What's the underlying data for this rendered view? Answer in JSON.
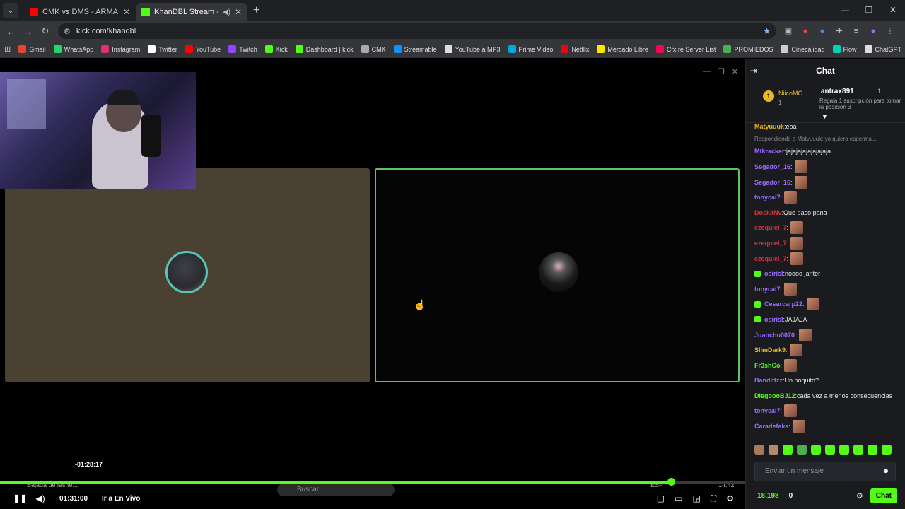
{
  "browser": {
    "tabs": [
      {
        "title": "CMK vs DMS - ARMAS LARGAS",
        "color": "#ff0000"
      },
      {
        "title": "KhanDBL Stream - Watch Li",
        "color": "#53fc18"
      }
    ],
    "url": "kick.com/khandbl",
    "bookmarks": [
      {
        "label": "Gmail",
        "color": "#ea4335"
      },
      {
        "label": "WhatsApp",
        "color": "#25d366"
      },
      {
        "label": "Instagram",
        "color": "#e1306c"
      },
      {
        "label": "Twitter",
        "color": "#ffffff"
      },
      {
        "label": "YouTube",
        "color": "#ff0000"
      },
      {
        "label": "Twitch",
        "color": "#9146ff"
      },
      {
        "label": "Kick",
        "color": "#53fc18"
      },
      {
        "label": "Dashboard | kick",
        "color": "#53fc18"
      },
      {
        "label": "CMK",
        "color": "#aaaaaa"
      },
      {
        "label": "Streamable",
        "color": "#0f90fa"
      },
      {
        "label": "YouTube a MP3",
        "color": "#dddddd"
      },
      {
        "label": "Prime Video",
        "color": "#00a8e1"
      },
      {
        "label": "Netflix",
        "color": "#e50914"
      },
      {
        "label": "Mercado Libre",
        "color": "#ffe600"
      },
      {
        "label": "Cfx.re Server List",
        "color": "#f40552"
      },
      {
        "label": "PROMIEDOS",
        "color": "#4caf50"
      },
      {
        "label": "Cinecalidad",
        "color": "#cccccc"
      },
      {
        "label": "Flow",
        "color": "#00d4b4"
      },
      {
        "label": "ChatGPT",
        "color": "#dddddd"
      }
    ]
  },
  "player": {
    "seek_tooltip": "-01:28:17",
    "timecode": "01:31:00",
    "go_live": "Ir a En Vivo",
    "taskbar_ghost": {
      "notice": "Bajada de las te...",
      "search": "Buscar",
      "lang": "ESP",
      "clock": "14:42"
    },
    "accent": "#53fc18",
    "progress_pct": 90
  },
  "chat": {
    "title": "Chat",
    "pinned": {
      "rank": "1",
      "top_gifter": "NiicoMC",
      "top_gifter_count": "1",
      "second_gifter": "antrax891",
      "second_count": "1",
      "cta": "Regala 1 suscripción para tomar la posición 3"
    },
    "messages": [
      {
        "user": "Matyuuuk",
        "color": "#e8b923",
        "text": "eoa"
      },
      {
        "reply": "Respondiendo a Matyuuuk: yo quiero esperma..."
      },
      {
        "user": "Mtkracker",
        "color": "#9b6cff",
        "text": "jajajajajajajajaja"
      },
      {
        "user": "Segador_16",
        "color": "#9b6cff",
        "emote": true
      },
      {
        "user": "Segador_16",
        "color": "#9b6cff",
        "emote": true
      },
      {
        "user": "tonycai7",
        "color": "#9b6cff",
        "emote": true
      },
      {
        "user": "DoskaNv",
        "color": "#e0303a",
        "text": "Que paso pana"
      },
      {
        "user": "ezequiel_7",
        "color": "#e0303a",
        "emote": true
      },
      {
        "user": "ezequiel_7",
        "color": "#e0303a",
        "emote": true
      },
      {
        "user": "ezequiel_7",
        "color": "#e0303a",
        "emote": true
      },
      {
        "user": "osirisl",
        "color": "#9b6cff",
        "text": "noooo janter",
        "sub": true
      },
      {
        "user": "tonycai7",
        "color": "#9b6cff",
        "emote": true
      },
      {
        "user": "Cesarcarp22",
        "color": "#9b6cff",
        "emote": true,
        "sub": true
      },
      {
        "user": "osirisl",
        "color": "#9b6cff",
        "text": "JAJAJA",
        "sub": true
      },
      {
        "user": "Juancho0070",
        "color": "#9b6cff",
        "emote": true
      },
      {
        "user": "SlimDark9",
        "color": "#e8b923",
        "emote": true
      },
      {
        "user": "Fr3shCo",
        "color": "#53fc18",
        "emote": true
      },
      {
        "user": "Bandittzz",
        "color": "#9b6cff",
        "text": "Un poquito?"
      },
      {
        "user": "DiegoooBJ12",
        "color": "#53fc18",
        "text": "cada vez a menos consecuencias"
      },
      {
        "user": "tonycai7",
        "color": "#9b6cff",
        "emote": true
      },
      {
        "user": "Caradefaka",
        "color": "#9b6cff",
        "emote": true
      }
    ],
    "input_placeholder": "Enviar un mensaje",
    "points": "18.198",
    "points2": "0",
    "send_label": "Chat"
  }
}
